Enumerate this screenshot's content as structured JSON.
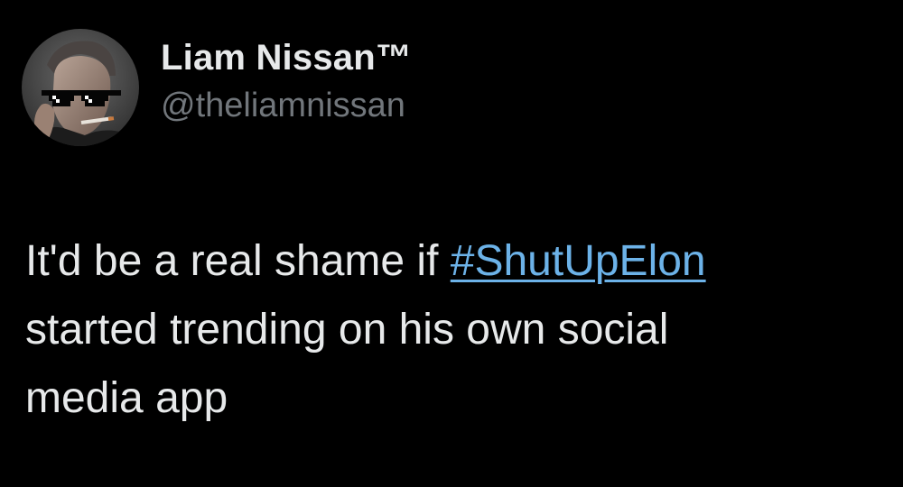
{
  "author": {
    "display_name": "Liam Nissan™",
    "handle": "@theliamnissan"
  },
  "tweet": {
    "line1_prefix": "It'd be a real shame if ",
    "hashtag": "#ShutUpElon",
    "line2": "started trending on his own social",
    "line3": "media app"
  },
  "icons": {
    "avatar": "profile-photo-man-pixel-sunglasses"
  },
  "colors": {
    "background": "#000000",
    "text": "#e7e9ea",
    "handle": "#71767b",
    "hashtag": "#6cb2e8"
  }
}
